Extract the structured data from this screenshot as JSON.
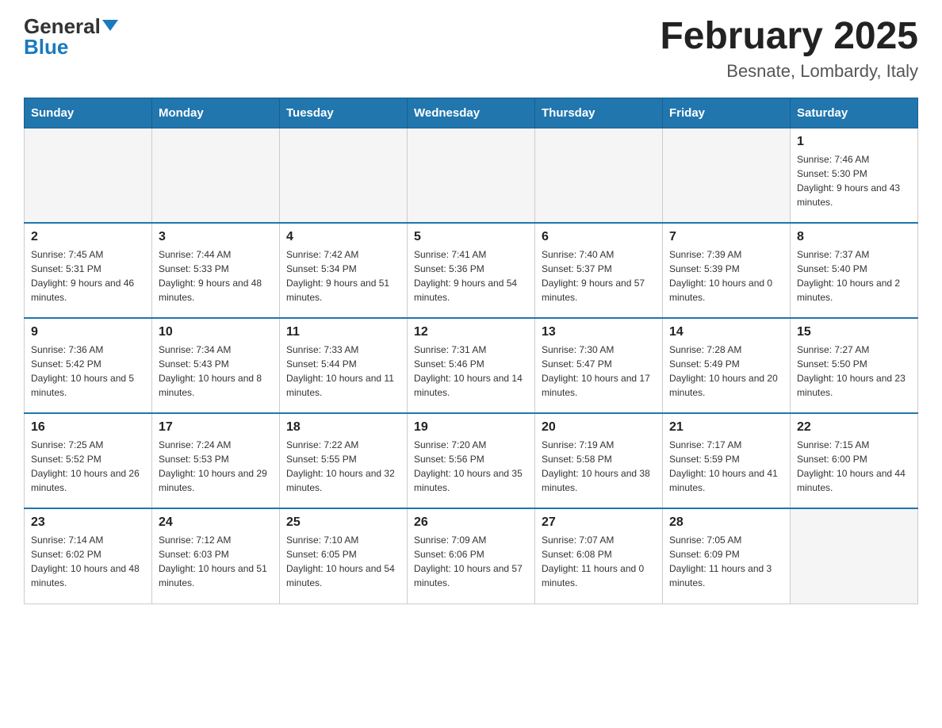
{
  "header": {
    "logo_general": "General",
    "logo_blue": "Blue",
    "month_title": "February 2025",
    "location": "Besnate, Lombardy, Italy"
  },
  "days_of_week": [
    "Sunday",
    "Monday",
    "Tuesday",
    "Wednesday",
    "Thursday",
    "Friday",
    "Saturday"
  ],
  "weeks": [
    [
      {
        "day": "",
        "info": ""
      },
      {
        "day": "",
        "info": ""
      },
      {
        "day": "",
        "info": ""
      },
      {
        "day": "",
        "info": ""
      },
      {
        "day": "",
        "info": ""
      },
      {
        "day": "",
        "info": ""
      },
      {
        "day": "1",
        "info": "Sunrise: 7:46 AM\nSunset: 5:30 PM\nDaylight: 9 hours and 43 minutes."
      }
    ],
    [
      {
        "day": "2",
        "info": "Sunrise: 7:45 AM\nSunset: 5:31 PM\nDaylight: 9 hours and 46 minutes."
      },
      {
        "day": "3",
        "info": "Sunrise: 7:44 AM\nSunset: 5:33 PM\nDaylight: 9 hours and 48 minutes."
      },
      {
        "day": "4",
        "info": "Sunrise: 7:42 AM\nSunset: 5:34 PM\nDaylight: 9 hours and 51 minutes."
      },
      {
        "day": "5",
        "info": "Sunrise: 7:41 AM\nSunset: 5:36 PM\nDaylight: 9 hours and 54 minutes."
      },
      {
        "day": "6",
        "info": "Sunrise: 7:40 AM\nSunset: 5:37 PM\nDaylight: 9 hours and 57 minutes."
      },
      {
        "day": "7",
        "info": "Sunrise: 7:39 AM\nSunset: 5:39 PM\nDaylight: 10 hours and 0 minutes."
      },
      {
        "day": "8",
        "info": "Sunrise: 7:37 AM\nSunset: 5:40 PM\nDaylight: 10 hours and 2 minutes."
      }
    ],
    [
      {
        "day": "9",
        "info": "Sunrise: 7:36 AM\nSunset: 5:42 PM\nDaylight: 10 hours and 5 minutes."
      },
      {
        "day": "10",
        "info": "Sunrise: 7:34 AM\nSunset: 5:43 PM\nDaylight: 10 hours and 8 minutes."
      },
      {
        "day": "11",
        "info": "Sunrise: 7:33 AM\nSunset: 5:44 PM\nDaylight: 10 hours and 11 minutes."
      },
      {
        "day": "12",
        "info": "Sunrise: 7:31 AM\nSunset: 5:46 PM\nDaylight: 10 hours and 14 minutes."
      },
      {
        "day": "13",
        "info": "Sunrise: 7:30 AM\nSunset: 5:47 PM\nDaylight: 10 hours and 17 minutes."
      },
      {
        "day": "14",
        "info": "Sunrise: 7:28 AM\nSunset: 5:49 PM\nDaylight: 10 hours and 20 minutes."
      },
      {
        "day": "15",
        "info": "Sunrise: 7:27 AM\nSunset: 5:50 PM\nDaylight: 10 hours and 23 minutes."
      }
    ],
    [
      {
        "day": "16",
        "info": "Sunrise: 7:25 AM\nSunset: 5:52 PM\nDaylight: 10 hours and 26 minutes."
      },
      {
        "day": "17",
        "info": "Sunrise: 7:24 AM\nSunset: 5:53 PM\nDaylight: 10 hours and 29 minutes."
      },
      {
        "day": "18",
        "info": "Sunrise: 7:22 AM\nSunset: 5:55 PM\nDaylight: 10 hours and 32 minutes."
      },
      {
        "day": "19",
        "info": "Sunrise: 7:20 AM\nSunset: 5:56 PM\nDaylight: 10 hours and 35 minutes."
      },
      {
        "day": "20",
        "info": "Sunrise: 7:19 AM\nSunset: 5:58 PM\nDaylight: 10 hours and 38 minutes."
      },
      {
        "day": "21",
        "info": "Sunrise: 7:17 AM\nSunset: 5:59 PM\nDaylight: 10 hours and 41 minutes."
      },
      {
        "day": "22",
        "info": "Sunrise: 7:15 AM\nSunset: 6:00 PM\nDaylight: 10 hours and 44 minutes."
      }
    ],
    [
      {
        "day": "23",
        "info": "Sunrise: 7:14 AM\nSunset: 6:02 PM\nDaylight: 10 hours and 48 minutes."
      },
      {
        "day": "24",
        "info": "Sunrise: 7:12 AM\nSunset: 6:03 PM\nDaylight: 10 hours and 51 minutes."
      },
      {
        "day": "25",
        "info": "Sunrise: 7:10 AM\nSunset: 6:05 PM\nDaylight: 10 hours and 54 minutes."
      },
      {
        "day": "26",
        "info": "Sunrise: 7:09 AM\nSunset: 6:06 PM\nDaylight: 10 hours and 57 minutes."
      },
      {
        "day": "27",
        "info": "Sunrise: 7:07 AM\nSunset: 6:08 PM\nDaylight: 11 hours and 0 minutes."
      },
      {
        "day": "28",
        "info": "Sunrise: 7:05 AM\nSunset: 6:09 PM\nDaylight: 11 hours and 3 minutes."
      },
      {
        "day": "",
        "info": ""
      }
    ]
  ]
}
